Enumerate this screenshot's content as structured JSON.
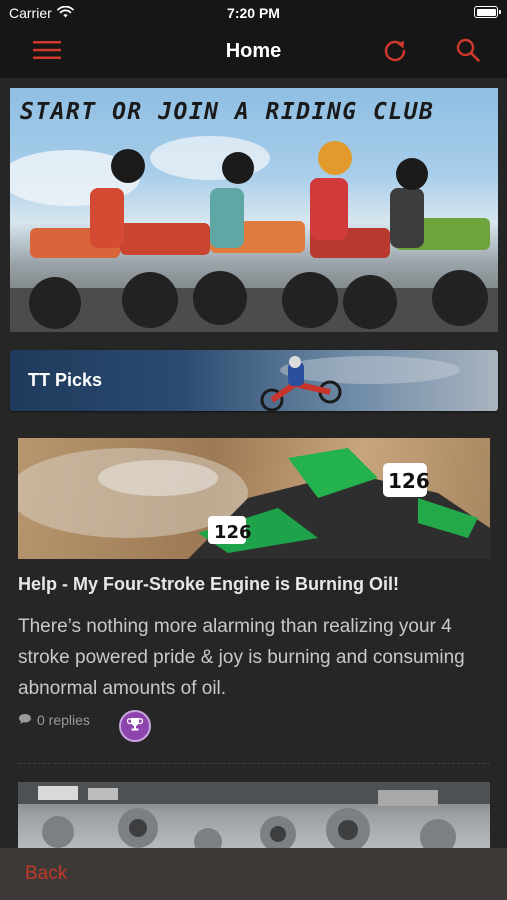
{
  "status_bar": {
    "carrier": "Carrier",
    "time": "7:20 PM"
  },
  "nav": {
    "title": "Home",
    "menu_icon": "hamburger-menu-icon",
    "refresh_icon": "refresh-icon",
    "search_icon": "search-icon",
    "accent_color": "#d0392b"
  },
  "banner": {
    "text": "START OR JOIN A RIDING CLUB"
  },
  "tt_picks": {
    "label": "TT Picks"
  },
  "articles": [
    {
      "title": "Help - My Four-Stroke Engine is Burning Oil!",
      "excerpt": "There’s nothing more alarming than realizing your 4 stroke powered pride & joy is burning and consuming abnormal amounts of oil.",
      "replies": "0 replies",
      "reply_icon": "speech-bubble-icon",
      "badge_icon": "trophy-icon",
      "badge_color": "#8e44ad"
    }
  ],
  "footer": {
    "back_label": "Back"
  }
}
